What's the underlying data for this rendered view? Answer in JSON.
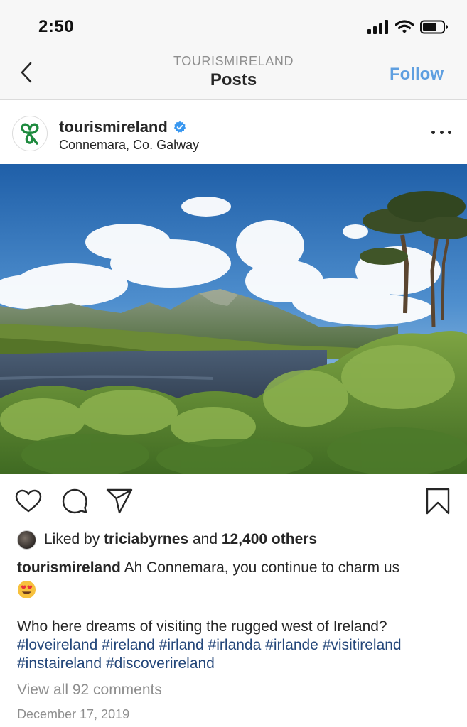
{
  "status_bar": {
    "time": "2:50",
    "icons": [
      "signal-icon",
      "wifi-icon",
      "battery-icon"
    ]
  },
  "nav": {
    "account": "TOURISMIRELAND",
    "title": "Posts",
    "follow_label": "Follow",
    "back_icon": "chevron-left-icon"
  },
  "post": {
    "username": "tourismireland",
    "verified": true,
    "location": "Connemara, Co. Galway",
    "avatar_icon": "shamrock-logo",
    "more_icon": "more-dots-icon",
    "image_description": ""
  },
  "actions": {
    "icons": [
      "heart-icon",
      "comment-icon",
      "share-icon",
      "bookmark-icon"
    ]
  },
  "likes": {
    "prefix": "Liked by",
    "liker": "triciabyrnes",
    "joiner": "and",
    "others": "12,400 others"
  },
  "caption": {
    "username": "tourismireland",
    "text": "Ah Connemara, you continue to charm us",
    "emoji": "😍",
    "body": "Who here dreams of visiting the rugged west of Ireland?",
    "hashtags": [
      "#loveireland",
      "#ireland",
      "#irland",
      "#irlanda",
      "#irlande",
      "#visitireland",
      "#instaireland",
      "#discoverireland"
    ]
  },
  "view_comments": "View all 92 comments",
  "date": "December 17, 2019",
  "colors": {
    "follow_blue": "#5f9fe0",
    "hashtag_blue": "#24477a",
    "verified_blue": "#3897f0",
    "shamrock_green": "#1e8a3e"
  }
}
